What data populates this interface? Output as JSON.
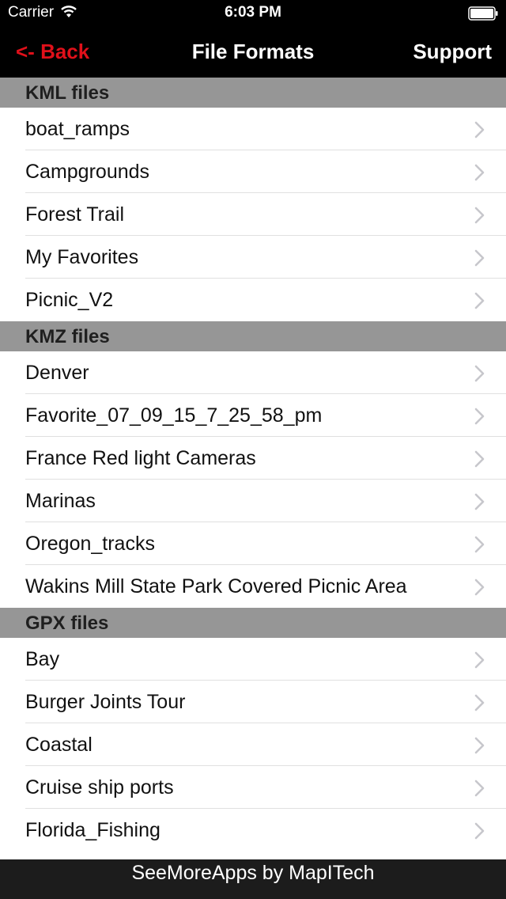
{
  "status_bar": {
    "carrier": "Carrier",
    "time": "6:03 PM",
    "wifi_icon": "wifi-icon",
    "battery_icon": "battery-icon"
  },
  "nav": {
    "back_label": "<- Back",
    "title": "File Formats",
    "support_label": "Support"
  },
  "colors": {
    "back_accent": "#e0101a",
    "section_header_bg": "#969696",
    "bar_bg": "#000000"
  },
  "sections": [
    {
      "header": "KML files",
      "items": [
        "boat_ramps",
        "Campgrounds",
        "Forest Trail",
        "My Favorites",
        "Picnic_V2"
      ]
    },
    {
      "header": "KMZ files",
      "items": [
        "Denver",
        "Favorite_07_09_15_7_25_58_pm",
        "France Red light Cameras",
        "Marinas",
        "Oregon_tracks",
        "Wakins Mill State Park Covered Picnic Area"
      ]
    },
    {
      "header": "GPX files",
      "items": [
        "Bay",
        "Burger Joints Tour",
        "Coastal",
        "Cruise ship ports",
        "Florida_Fishing"
      ]
    }
  ],
  "footer": {
    "label": "SeeMoreApps by MapITech"
  }
}
